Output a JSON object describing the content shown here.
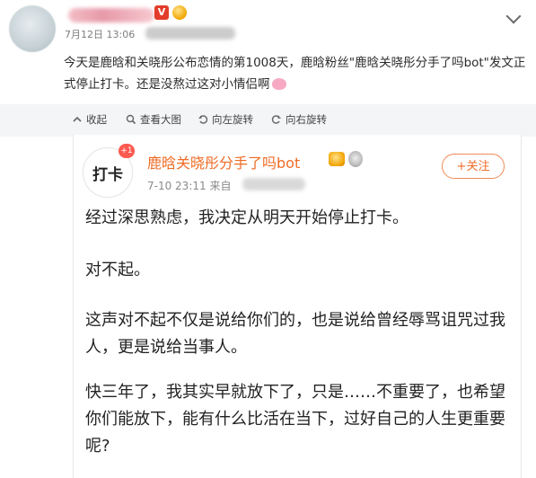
{
  "post": {
    "date": "7月12日 13:06",
    "text": "今天是鹿晗和关晓彤公布恋情的第1008天，鹿晗粉丝\"鹿晗关晓彤分手了吗bot\"发文正式停止打卡。还是没熬过这对小情侣啊",
    "icons": {
      "vip": "v-badge",
      "gold": "gold-badge"
    }
  },
  "toolbar": {
    "items": [
      {
        "label": "收起",
        "icon": "collapse-icon"
      },
      {
        "label": "查看大图",
        "icon": "view-large-icon"
      },
      {
        "label": "向左旋转",
        "icon": "rotate-left-icon"
      },
      {
        "label": "向右旋转",
        "icon": "rotate-right-icon"
      }
    ]
  },
  "account": {
    "avatar_text": "打卡",
    "badge_count": "+1",
    "name": "鹿晗关晓彤分手了吗bot",
    "meta": "7-10 23:11  来自",
    "follow_label": "+关注",
    "accent": "#ef6b24"
  },
  "content": {
    "paragraphs": [
      "经过深思熟虑，我决定从明天开始停止打卡。",
      "对不起。",
      "这声对不起不仅是说给你们的，也是说给曾经辱骂诅咒过我人，更是说给当事人。",
      "快三年了，我其实早就放下了，只是……不重要了，也希望你们能放下，能有什么比活在当下，过好自己的人生更重要呢?"
    ]
  }
}
